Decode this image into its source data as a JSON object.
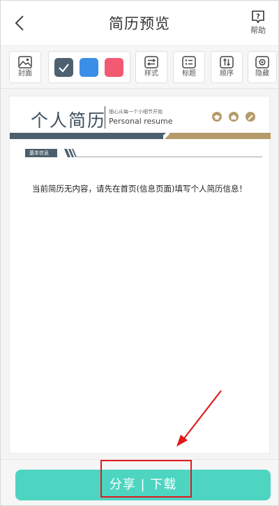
{
  "header": {
    "title": "简历预览",
    "help_label": "帮助"
  },
  "toolbar": {
    "cover_label": "封面",
    "style_label": "样式",
    "heading_label": "标题",
    "order_label": "顺序",
    "hide_label": "隐藏",
    "colors": [
      "#4d6170",
      "#3a8ee6",
      "#f25a74"
    ],
    "selected_color_index": 0
  },
  "resume": {
    "title": "个人简历",
    "slogan": "细心从每一个小细节开始",
    "subtitle_en": "Personal resume",
    "section_label": "基本信息",
    "empty_message": "当前简历无内容，请先在首页(信息页面)填写个人简历信息！",
    "accent_dark": "#4d5f6c",
    "accent_gold": "#b59a6a"
  },
  "bottom": {
    "share_download_label": "分享 | 下载",
    "button_color": "#4dd5c2"
  }
}
